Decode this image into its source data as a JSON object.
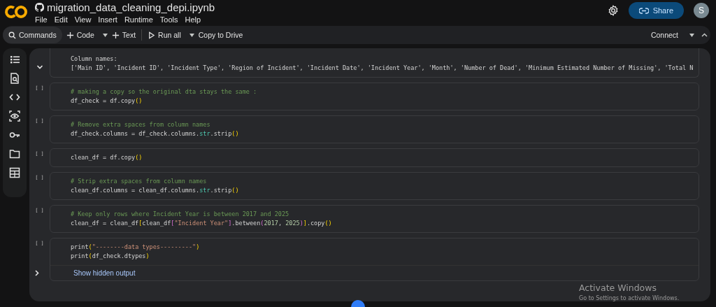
{
  "title": "migration_data_cleaning_depi.ipynb",
  "menu": [
    "File",
    "Edit",
    "View",
    "Insert",
    "Runtime",
    "Tools",
    "Help"
  ],
  "header": {
    "share": "Share",
    "avatar": "S"
  },
  "toolbar": {
    "items": [
      {
        "label": "Commands",
        "kind": "search",
        "dropdown": false
      },
      {
        "label": "Code",
        "kind": "add",
        "dropdown": true
      },
      {
        "label": "Text",
        "kind": "add",
        "dropdown": false
      },
      {
        "label": "Run all",
        "kind": "run",
        "dropdown": true
      },
      {
        "label": "Copy to Drive",
        "kind": "plain",
        "dropdown": false
      }
    ],
    "connect": "Connect"
  },
  "sidebar": {
    "items": [
      {
        "kind": "toc"
      },
      {
        "kind": "find"
      },
      {
        "kind": "code"
      },
      {
        "kind": "variables"
      },
      {
        "kind": "secrets"
      },
      {
        "kind": "files"
      },
      {
        "kind": "data"
      }
    ]
  },
  "cells": [
    {
      "kind": "output",
      "expanded": true,
      "lines": [
        "Column names:",
        "['Main ID', 'Incident ID', 'Incident Type', 'Region of Incident', 'Incident Date', 'Incident Year', 'Month', 'Number of Dead', 'Minimum Estimated Number of Missing', 'Total N"
      ]
    },
    {
      "kind": "code",
      "marker": "[ ]",
      "lines": [
        [
          {
            "text": "# making a copy so the original dta stays the same :",
            "kind": "comment"
          }
        ],
        [
          {
            "text": "df_check = df.copy",
            "kind": "plain"
          },
          {
            "text": "()",
            "kind": "bracket1"
          }
        ]
      ]
    },
    {
      "kind": "code",
      "marker": "[ ]",
      "lines": [
        [
          {
            "text": "# Remove extra spaces from column names",
            "kind": "comment"
          }
        ],
        [
          {
            "text": "df_check.columns = df_check.columns.",
            "kind": "plain"
          },
          {
            "text": "str",
            "kind": "builtin"
          },
          {
            "text": ".strip",
            "kind": "plain"
          },
          {
            "text": "()",
            "kind": "bracket1"
          }
        ]
      ]
    },
    {
      "kind": "code",
      "marker": "[ ]",
      "lines": [
        [
          {
            "text": "clean_df = df.copy",
            "kind": "plain"
          },
          {
            "text": "()",
            "kind": "bracket1"
          }
        ]
      ]
    },
    {
      "kind": "code",
      "marker": "[ ]",
      "lines": [
        [
          {
            "text": "# Strip extra spaces from column names",
            "kind": "comment"
          }
        ],
        [
          {
            "text": "clean_df.columns = clean_df.columns.",
            "kind": "plain"
          },
          {
            "text": "str",
            "kind": "builtin"
          },
          {
            "text": ".strip",
            "kind": "plain"
          },
          {
            "text": "()",
            "kind": "bracket1"
          }
        ]
      ]
    },
    {
      "kind": "code",
      "marker": "[ ]",
      "lines": [
        [
          {
            "text": "# Keep only rows where Incident Year is between 2017 and 2025",
            "kind": "comment"
          }
        ],
        [
          {
            "text": "clean_df = clean_df",
            "kind": "plain"
          },
          {
            "text": "[",
            "kind": "bracket1"
          },
          {
            "text": "clean_df",
            "kind": "plain"
          },
          {
            "text": "[",
            "kind": "bracket2"
          },
          {
            "text": "\"Incident Year\"",
            "kind": "string"
          },
          {
            "text": "]",
            "kind": "bracket2"
          },
          {
            "text": ".between",
            "kind": "plain"
          },
          {
            "text": "(",
            "kind": "bracket2"
          },
          {
            "text": "2017",
            "kind": "number"
          },
          {
            "text": ", ",
            "kind": "plain"
          },
          {
            "text": "2025",
            "kind": "number"
          },
          {
            "text": ")",
            "kind": "bracket2"
          },
          {
            "text": "]",
            "kind": "bracket1"
          },
          {
            "text": ".copy",
            "kind": "plain"
          },
          {
            "text": "()",
            "kind": "bracket1"
          }
        ]
      ]
    },
    {
      "kind": "code",
      "marker": "[ ]",
      "lines": [
        [
          {
            "text": "print",
            "kind": "plain"
          },
          {
            "text": "(",
            "kind": "bracket1"
          },
          {
            "text": "\"--------data types---------\"",
            "kind": "string"
          },
          {
            "text": ")",
            "kind": "bracket1"
          }
        ],
        [
          {
            "text": "print",
            "kind": "plain"
          },
          {
            "text": "(",
            "kind": "bracket1"
          },
          {
            "text": "df_check.dtypes",
            "kind": "plain"
          },
          {
            "text": ")",
            "kind": "bracket1"
          }
        ]
      ],
      "hidden_output": {
        "expanded": false,
        "label": "Show hidden output"
      }
    }
  ],
  "overlay": {
    "title": "Activate Windows",
    "subtitle": "Go to Settings to activate Windows."
  }
}
